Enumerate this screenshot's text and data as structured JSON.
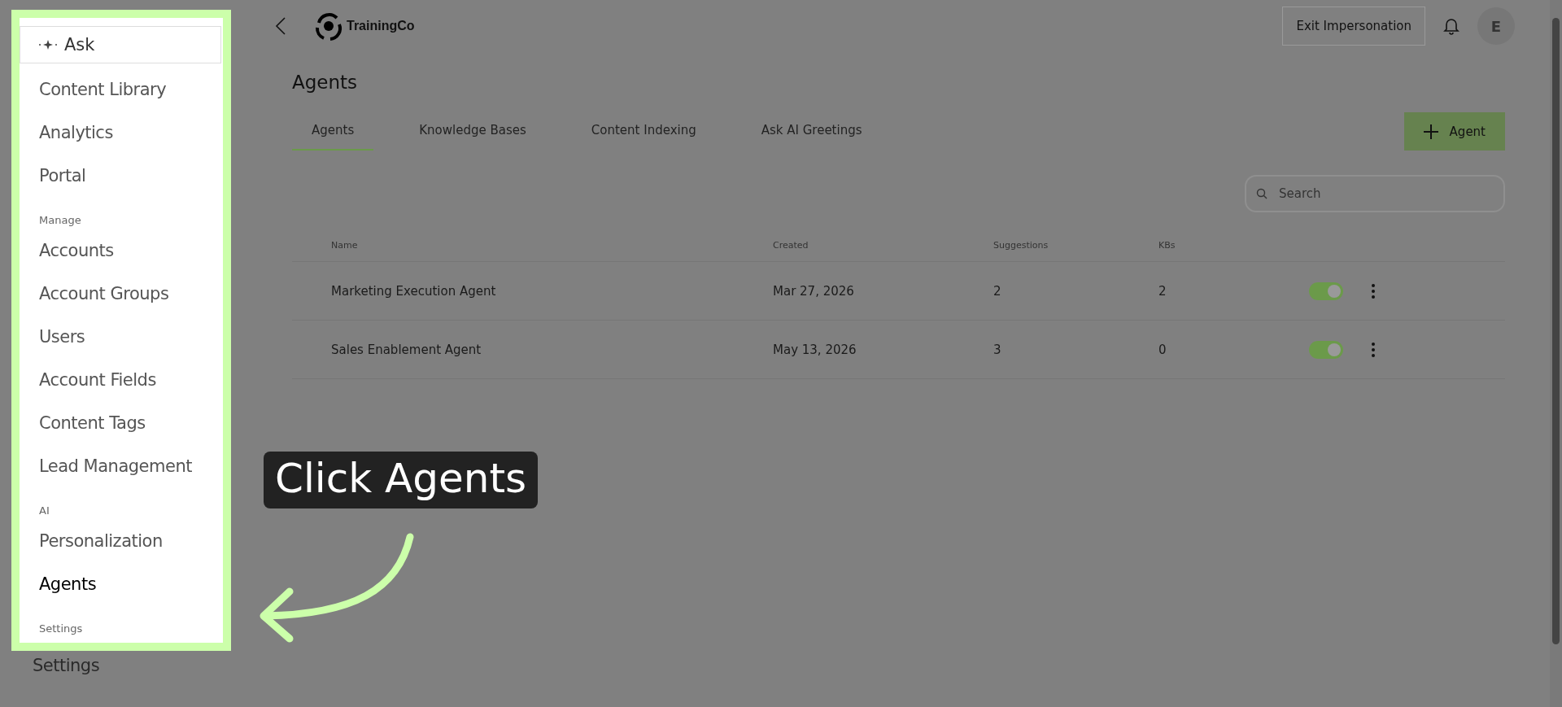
{
  "sidebar": {
    "ask": {
      "label": "Ask"
    },
    "items": [
      {
        "kind": "link",
        "label": "Content Library",
        "selected": false
      },
      {
        "kind": "link",
        "label": "Analytics",
        "selected": false
      },
      {
        "kind": "link",
        "label": "Portal",
        "selected": false
      },
      {
        "kind": "section",
        "label": "Manage"
      },
      {
        "kind": "link",
        "label": "Accounts",
        "selected": false
      },
      {
        "kind": "link",
        "label": "Account Groups",
        "selected": false
      },
      {
        "kind": "link",
        "label": "Users",
        "selected": false
      },
      {
        "kind": "link",
        "label": "Account Fields",
        "selected": false
      },
      {
        "kind": "link",
        "label": "Content Tags",
        "selected": false
      },
      {
        "kind": "link",
        "label": "Lead Management",
        "selected": false
      },
      {
        "kind": "section",
        "label": "AI"
      },
      {
        "kind": "link",
        "label": "Personalization",
        "selected": false
      },
      {
        "kind": "link",
        "label": "Agents",
        "selected": true
      },
      {
        "kind": "section",
        "label": "Settings"
      }
    ],
    "items_below": [
      {
        "kind": "link",
        "label": "Settings"
      }
    ]
  },
  "header": {
    "logo": "TrainingCo",
    "exit_button": "Exit Impersonation",
    "avatar": "E"
  },
  "page": {
    "title": "Agents",
    "tabs": [
      {
        "label": "Agents",
        "selected": true
      },
      {
        "label": "Knowledge Bases",
        "selected": false
      },
      {
        "label": "Content Indexing",
        "selected": false
      },
      {
        "label": "Ask AI Greetings",
        "selected": false
      }
    ],
    "add_button": "Agent",
    "search": {
      "placeholder": "Search"
    },
    "table": {
      "columns": [
        "Name",
        "Created",
        "Suggestions",
        "KBs"
      ],
      "rows": [
        {
          "name": "Marketing Execution Agent",
          "created": "Mar 27, 2026",
          "suggestions": "2",
          "kbs": "2",
          "on": true
        },
        {
          "name": "Sales Enablement Agent",
          "created": "May 13, 2026",
          "suggestions": "3",
          "kbs": "0",
          "on": true
        }
      ]
    }
  },
  "callout": {
    "text": "Click Agents"
  }
}
